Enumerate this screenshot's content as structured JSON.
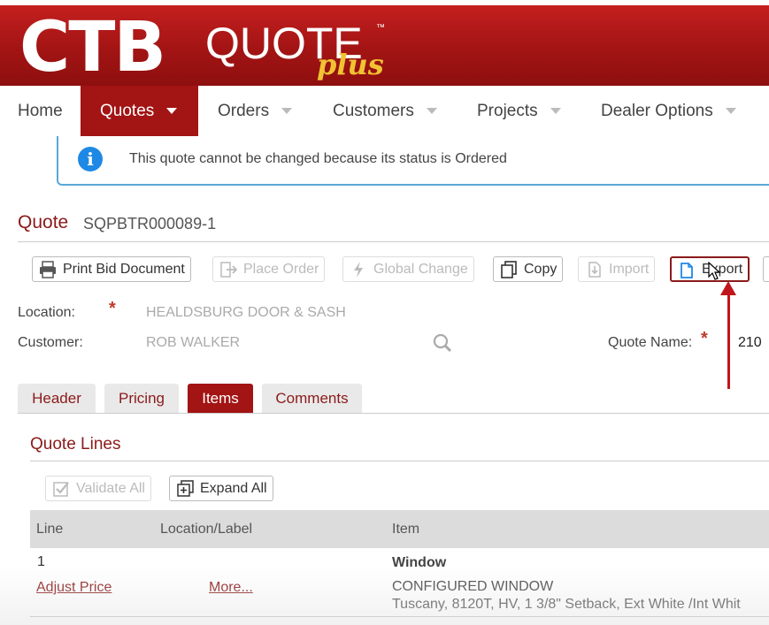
{
  "logo": {
    "ctb": "CTB",
    "quote": "QUOTE",
    "tm": "™",
    "plus": "plus"
  },
  "nav": {
    "home": "Home",
    "quotes": "Quotes",
    "orders": "Orders",
    "customers": "Customers",
    "projects": "Projects",
    "dealer_options": "Dealer Options"
  },
  "alert": {
    "icon": "info-icon",
    "text": "This quote cannot be changed because its status is Ordered"
  },
  "quote": {
    "title": "Quote",
    "id": "SQPBTR000089-1"
  },
  "toolbar": {
    "print": "Print Bid Document",
    "place_order": "Place Order",
    "global_change": "Global Change",
    "copy": "Copy",
    "import": "Import",
    "export": "Export"
  },
  "fields": {
    "location_label": "Location:",
    "location_value": "HEALDSBURG DOOR & SASH",
    "customer_label": "Customer:",
    "customer_value": "ROB WALKER",
    "quote_name_label": "Quote Name:",
    "quote_name_value": "210",
    "required_mark": "*"
  },
  "tabs": {
    "header": "Header",
    "pricing": "Pricing",
    "items": "Items",
    "comments": "Comments"
  },
  "quote_lines": {
    "title": "Quote Lines",
    "validate_all": "Validate All",
    "expand_all": "Expand All",
    "columns": {
      "line": "Line",
      "location_label": "Location/Label",
      "item": "Item"
    },
    "rows": [
      {
        "line": "1",
        "adjust_price": "Adjust Price",
        "more": "More...",
        "item_title": "Window",
        "item_subtitle": "CONFIGURED WINDOW",
        "item_desc": "Tuscany, 8120T, HV, 1 3/8\" Setback, Ext White /Int Whit"
      }
    ]
  },
  "colors": {
    "brand_red": "#a31414",
    "info_blue": "#1e88e5",
    "annotation_red": "#c0161b"
  }
}
